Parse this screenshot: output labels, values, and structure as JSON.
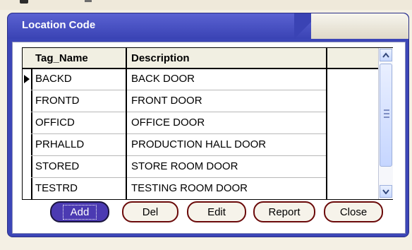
{
  "window": {
    "title": "Location Code"
  },
  "grid": {
    "columns": [
      "Tag_Name",
      "Description"
    ],
    "rows": [
      {
        "tag": "BACKD",
        "description": "BACK DOOR",
        "current": true
      },
      {
        "tag": "FRONTD",
        "description": "FRONT DOOR"
      },
      {
        "tag": "OFFICD",
        "description": "OFFICE DOOR"
      },
      {
        "tag": "PRHALLD",
        "description": "PRODUCTION HALL DOOR"
      },
      {
        "tag": "STORED",
        "description": "STORE ROOM DOOR"
      },
      {
        "tag": "TESTRD",
        "description": "TESTING ROOM DOOR"
      }
    ]
  },
  "buttons": {
    "add": "Add",
    "del": "Del",
    "edit": "Edit",
    "report": "Report",
    "close": "Close"
  },
  "colors": {
    "window_frame": "#3c46b7",
    "add_button": "#4b3ab2",
    "button_border": "#6b0a0a"
  }
}
